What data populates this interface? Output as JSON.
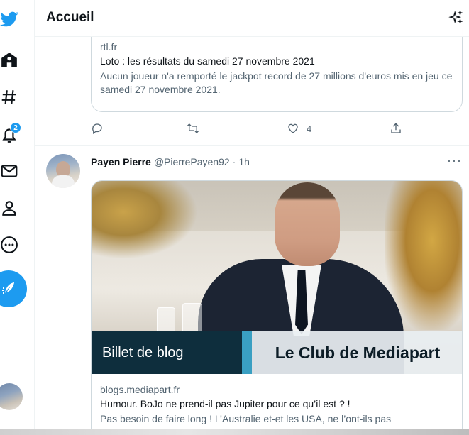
{
  "nav": {
    "notifications_badge": "2",
    "icons": [
      "twitter-logo-icon",
      "home-icon",
      "explore-hash-icon",
      "notifications-bell-icon",
      "messages-mail-icon",
      "profile-icon",
      "more-circle-icon",
      "compose-tweet-icon"
    ]
  },
  "header": {
    "title": "Accueil"
  },
  "tweet1": {
    "card": {
      "domain": "rtl.fr",
      "title": "Loto : les résultats du samedi 27 novembre 2021",
      "description": "Aucun joueur n'a remporté le jackpot record de 27 millions d'euros mis en jeu ce samedi 27 novembre 2021."
    },
    "actions": {
      "like_count": "4"
    }
  },
  "tweet2": {
    "name": "Payen Pierre",
    "handle": "@PierrePayen92",
    "dot": "·",
    "time": "1h",
    "more": "···",
    "card": {
      "banner_left": "Billet de blog",
      "banner_right": "Le Club de Mediapart",
      "domain": "blogs.mediapart.fr",
      "title": "Humour. BoJo ne prend-il pas Jupiter pour ce qu’il est ? !",
      "description": "Pas besoin de faire long ! L’Australie et-et les USA, ne l’ont-ils pas"
    }
  },
  "colors": {
    "accent": "#1d9bf0",
    "text": "#0f1419",
    "secondary": "#536471",
    "banner_dark": "#0e2e3d",
    "banner_stripe": "#3a9fc2"
  }
}
